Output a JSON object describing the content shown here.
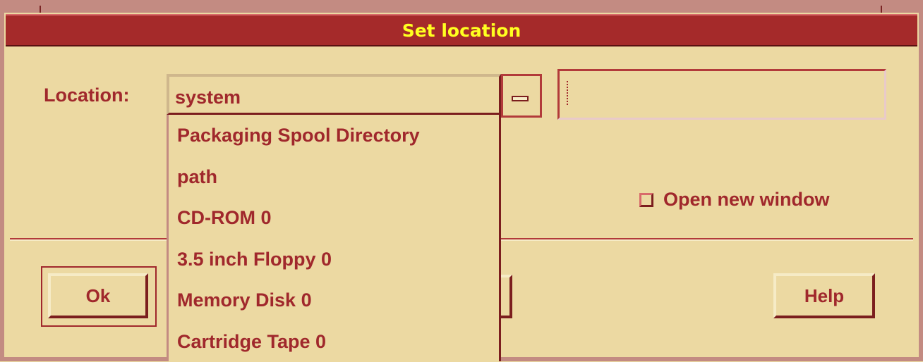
{
  "window": {
    "title": "Set location"
  },
  "location": {
    "label": "Location:",
    "selected": "system",
    "text_value": "",
    "options": [
      "Packaging Spool Directory",
      "path",
      "CD-ROM 0",
      "3.5 inch Floppy 0",
      "Memory Disk 0",
      "Cartridge Tape 0"
    ]
  },
  "open_new_window": {
    "label": "Open new window",
    "checked": false
  },
  "buttons": {
    "ok": "Ok",
    "help": "Help"
  },
  "colors": {
    "accent": "#a52a2a",
    "title_text": "#ffff20",
    "background": "#ecd9a2",
    "text": "#a0282c"
  }
}
